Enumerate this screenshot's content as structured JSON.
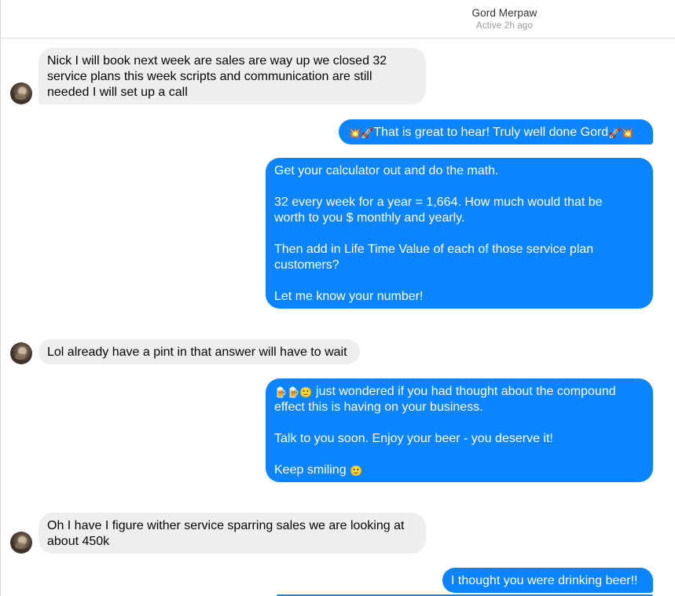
{
  "conversation": {
    "contact_name": "Gord Merpaw",
    "status": "Active 2h ago"
  },
  "messages": [
    {
      "direction": "in",
      "text": "Nick I will book next week are sales are way up we closed 32\nservice plans this week  scripts and communication are still\nneeded I will set up  a call"
    },
    {
      "direction": "out",
      "emoji_before": "💥🚀",
      "text": "That is great to hear! Truly well done Gord",
      "emoji_after": "🚀💥"
    },
    {
      "direction": "out",
      "text": "Get your calculator out and do the math.\n\n32 every week for a year = 1,664.  How much would that be\nworth to you $ monthly and yearly.\n\nThen add in Life Time Value of each of those service plan\ncustomers?\n\nLet me know your number!"
    },
    {
      "direction": "in",
      "text": "Lol already have a pint in that answer will have to wait"
    },
    {
      "direction": "out",
      "emoji_before": "🍺🍺🙂",
      "text": " just wondered if you had thought about the compound\neffect this is having on your business.\n\nTalk to you soon. Enjoy your beer - you deserve it!\n\nKeep smiling ",
      "emoji_after": "🙂"
    },
    {
      "direction": "in",
      "text": "Oh I have I figure wither service sparring sales we are looking at\nabout 450k"
    },
    {
      "direction": "out",
      "text": "I thought you were drinking beer!!"
    }
  ],
  "colors": {
    "outgoing_bubble": "#0a84ff",
    "incoming_bubble": "#efeeef",
    "header_text": "#333333",
    "status_text": "#999999"
  },
  "icons": {
    "avatar": "avatar"
  }
}
